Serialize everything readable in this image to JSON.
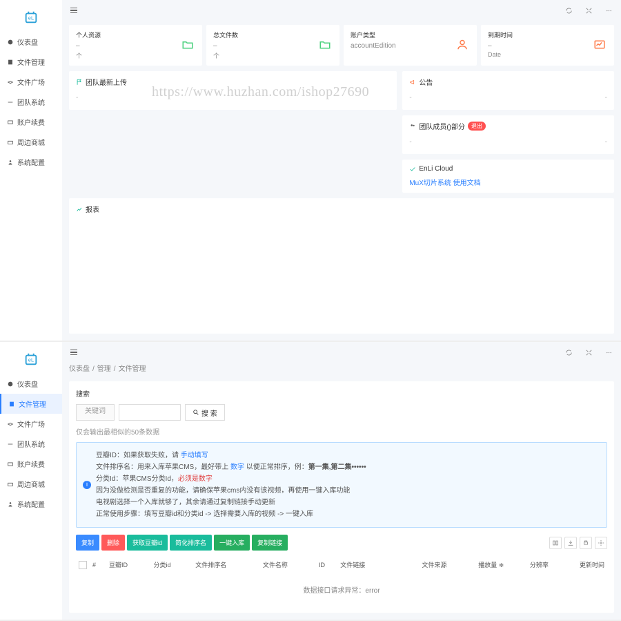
{
  "watermark": "https://www.huzhan.com/ishop27690",
  "nav": {
    "items": [
      {
        "label": "仪表盘",
        "icon": "dashboard"
      },
      {
        "label": "文件管理",
        "icon": "file"
      },
      {
        "label": "文件广场",
        "icon": "share"
      },
      {
        "label": "团队系统",
        "icon": "team"
      },
      {
        "label": "账户续费",
        "icon": "wallet"
      },
      {
        "label": "周边商城",
        "icon": "shop"
      },
      {
        "label": "系统配置",
        "icon": "gear"
      }
    ]
  },
  "stats": [
    {
      "title": "个人资源",
      "value": "–",
      "sub": "个"
    },
    {
      "title": "总文件数",
      "value": "–",
      "sub": "个"
    },
    {
      "title": "账户类型",
      "value": "accountEdition",
      "sub": ""
    },
    {
      "title": "到期时间",
      "value": "–",
      "sub": "Date"
    }
  ],
  "panels": {
    "upload": {
      "title": "团队最新上传",
      "dash": "-"
    },
    "announce": {
      "title": "公告",
      "dash": "-"
    },
    "members": {
      "title_prefix": "团队成员(",
      "title_suffix": ")部分",
      "badge": "退出",
      "dash": "-"
    },
    "enli": {
      "title": "EnLi Cloud",
      "link": "MuX切片系统 使用文档"
    },
    "report": {
      "title": "报表"
    }
  },
  "breadcrumb": [
    "仪表盘",
    "管理",
    "文件管理"
  ],
  "search": {
    "panel_title": "搜索",
    "kw_label": "关键词",
    "btn": "搜 索",
    "hint": "仅会输出最相似的50条数据"
  },
  "info": {
    "l1a": "豆瓣ID：如果获取失败，请 ",
    "l1b": "手动填写",
    "l2a": "文件排序名：用来入库苹果CMS，最好带上 ",
    "l2b": "数字",
    "l2c": " 以便正常排序，例：",
    "l2d": "第一集,第二集••••••",
    "l3a": "分类Id：苹果CMS分类Id，",
    "l3b": "必须是数字",
    "l4": "因为没做检测是否重复的功能，请确保苹果cms内没有该视频，再使用一键入库功能",
    "l5": "电视剧选择一个入库就够了，其余请通过复制链接手动更新",
    "l6": "正常使用步骤：填写豆瓣id和分类id -> 选择需要入库的视频 -> 一键入库"
  },
  "buttons": [
    "复制",
    "删除",
    "获取豆瓣id",
    "简化排序名",
    "一键入库",
    "复制链接"
  ],
  "columns": [
    "#",
    "豆瓣ID",
    "分类id",
    "文件排序名",
    "文件名称",
    "ID",
    "文件链接",
    "文件来源",
    "播放量 ≑",
    "分辨率",
    "更新时间"
  ],
  "error": "数据接口请求异常：error"
}
